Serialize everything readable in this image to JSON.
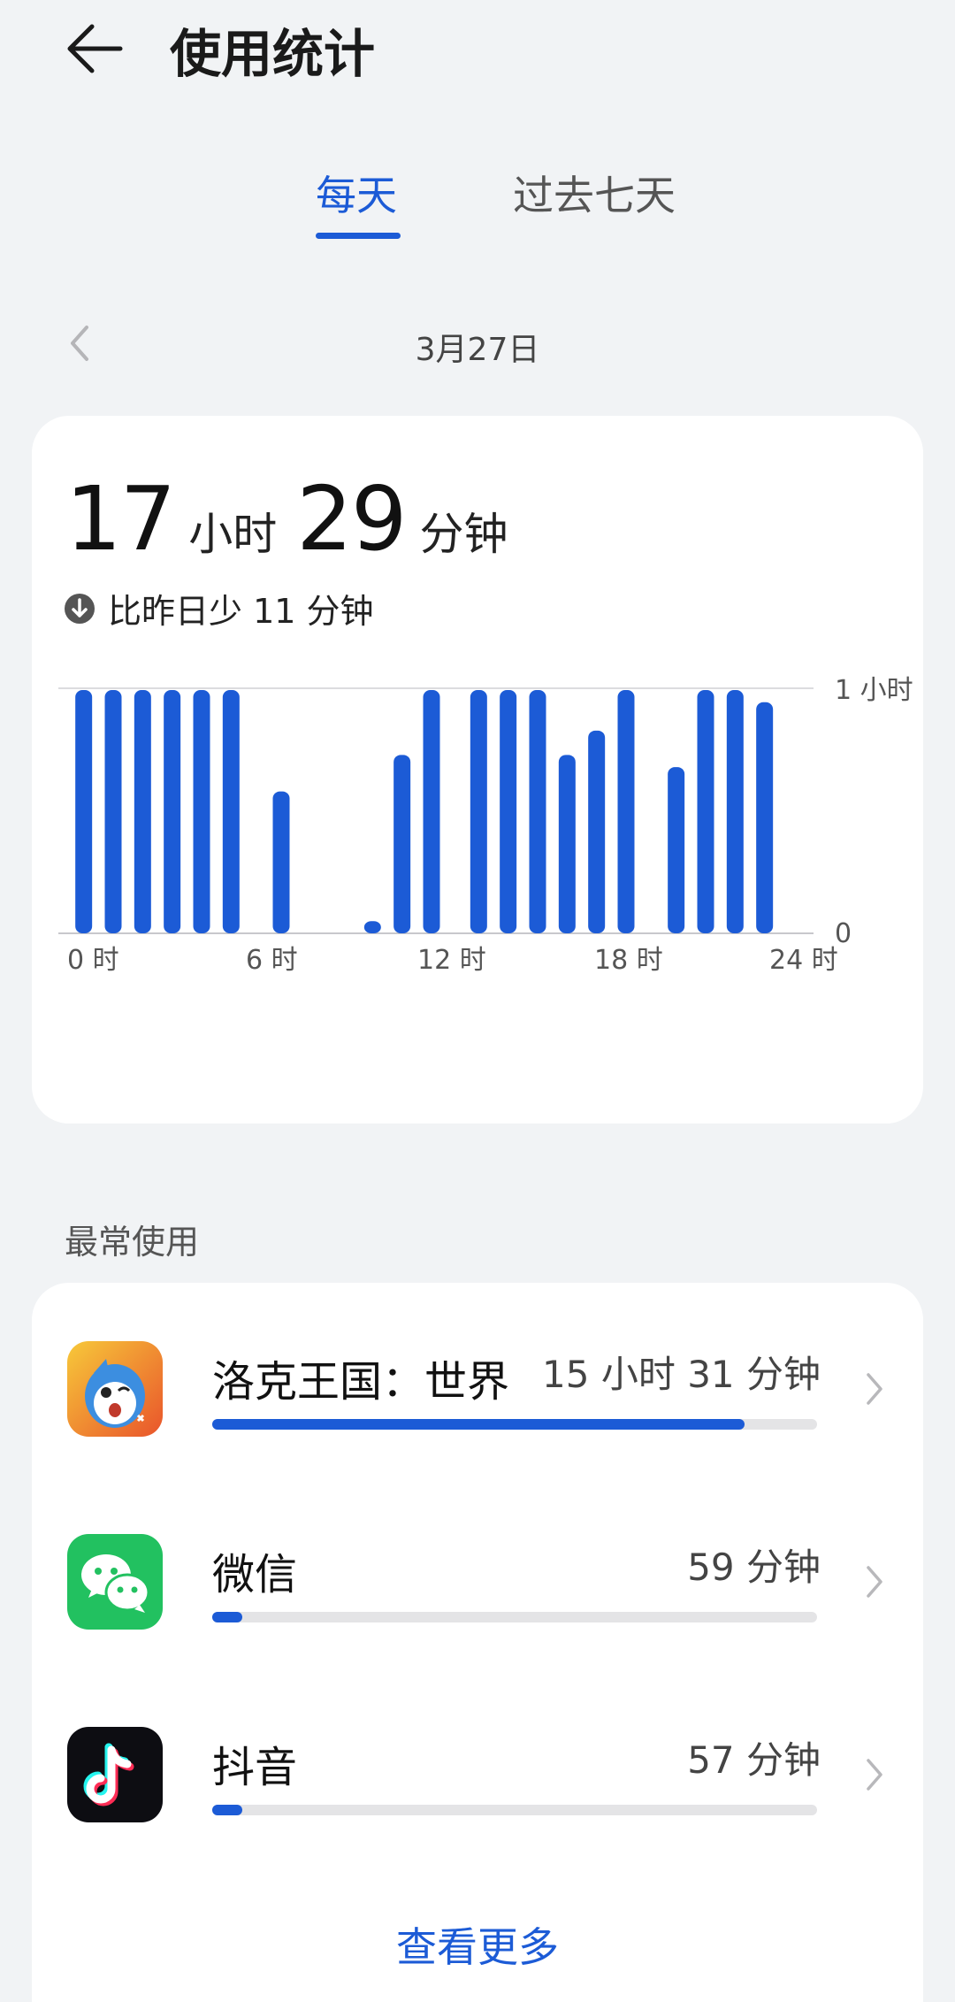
{
  "header": {
    "title": "使用统计"
  },
  "tabs": [
    {
      "label": "每天"
    },
    {
      "label": "过去七天"
    }
  ],
  "date": {
    "label": "3月27日"
  },
  "summary": {
    "hours": "17",
    "hours_unit": "小时",
    "minutes": "29",
    "minutes_unit": "分钟",
    "compare": "比昨日少 11 分钟"
  },
  "chart_data": {
    "type": "bar",
    "x_tick_labels": [
      "0 时",
      "6 时",
      "12 时",
      "18 时",
      "24 时"
    ],
    "y_tick_labels": [
      "1 小时",
      "0"
    ],
    "ylim": [
      0,
      60
    ],
    "bar_color": "#1c5bd6",
    "hours": [
      0,
      1,
      2,
      3,
      4,
      5,
      6,
      7,
      8,
      9,
      10,
      11,
      12,
      13,
      14,
      15,
      16,
      17,
      18,
      19,
      20,
      21,
      22,
      23
    ],
    "values_minutes": [
      60,
      60,
      60,
      60,
      60,
      60,
      0,
      0,
      0,
      0,
      0,
      0,
      0,
      0,
      0,
      0,
      0,
      0,
      0,
      0,
      0,
      0,
      0,
      0
    ],
    "bars": [
      {
        "slot": 0,
        "value": 60
      },
      {
        "slot": 1,
        "value": 60
      },
      {
        "slot": 2,
        "value": 60
      },
      {
        "slot": 3,
        "value": 60
      },
      {
        "slot": 4,
        "value": 60
      },
      {
        "slot": 5,
        "value": 60
      },
      {
        "slot": 6.7,
        "value": 35
      },
      {
        "slot": 9.8,
        "value": 3
      },
      {
        "slot": 10.8,
        "value": 44
      },
      {
        "slot": 11.8,
        "value": 60
      },
      {
        "slot": 13.4,
        "value": 60
      },
      {
        "slot": 14.4,
        "value": 60
      },
      {
        "slot": 15.4,
        "value": 60
      },
      {
        "slot": 16.4,
        "value": 44
      },
      {
        "slot": 17.4,
        "value": 50
      },
      {
        "slot": 18.4,
        "value": 60
      },
      {
        "slot": 20.1,
        "value": 41
      },
      {
        "slot": 21.1,
        "value": 60
      },
      {
        "slot": 22.1,
        "value": 60
      },
      {
        "slot": 23.1,
        "value": 57
      }
    ]
  },
  "section_title": "最常使用",
  "apps": [
    {
      "name": "洛克王国：世界",
      "time": "15 小时 31 分钟",
      "progress": 0.88,
      "icon": "roco-kingdom-icon"
    },
    {
      "name": "微信",
      "time": "59 分钟",
      "progress": 0.05,
      "icon": "wechat-icon"
    },
    {
      "name": "抖音",
      "time": "57 分钟",
      "progress": 0.05,
      "icon": "douyin-icon"
    }
  ],
  "see_more": "查看更多",
  "colors": {
    "accent": "#1c5bd6",
    "background": "#f1f3f5",
    "card": "#ffffff"
  }
}
